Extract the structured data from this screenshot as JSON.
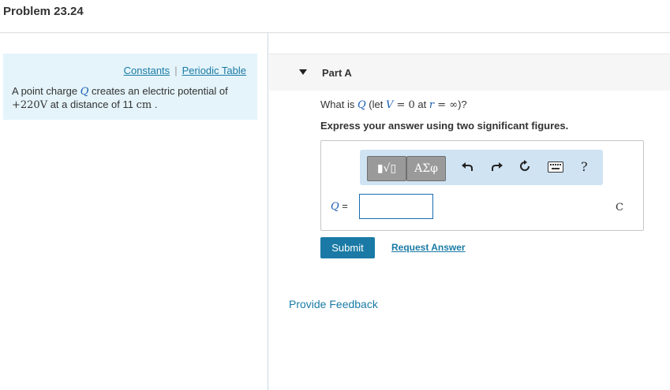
{
  "header": {
    "title": "Problem 23.24"
  },
  "info": {
    "links": [
      "Constants",
      "Periodic Table"
    ],
    "separator": "|",
    "text_pre": "A point charge ",
    "var_Q": "Q",
    "text_mid": " creates an electric potential of",
    "potential": "+220V",
    "text_dist": " at a distance of 11 ",
    "unit_cm": "cm",
    "text_end": " ."
  },
  "partA": {
    "label": "Part A",
    "question_pre": "What is ",
    "q_var": "Q",
    "question_let": " (let ",
    "v_var": "V",
    "eq_zero": " = 0",
    "at_text": " at ",
    "r_var": "r",
    "eq_inf": " = ∞",
    "question_end": ")?",
    "instruction": "Express your answer using two significant figures."
  },
  "toolbar": {
    "template_label": "▮√▯",
    "greek_label": "ΑΣφ",
    "icons": [
      "undo-icon",
      "redo-icon",
      "reset-icon",
      "keyboard-icon",
      "help-icon"
    ],
    "help_label": "?"
  },
  "answer": {
    "label_var": "Q",
    "label_eq": " =",
    "value": "",
    "units": "C"
  },
  "actions": {
    "submit_label": "Submit",
    "request_label": "Request Answer",
    "feedback_label": "Provide Feedback"
  },
  "colors": {
    "accent": "#1a7aa5",
    "info_bg": "#e4f4fa",
    "toolbar_bg": "#cfe3f3"
  }
}
